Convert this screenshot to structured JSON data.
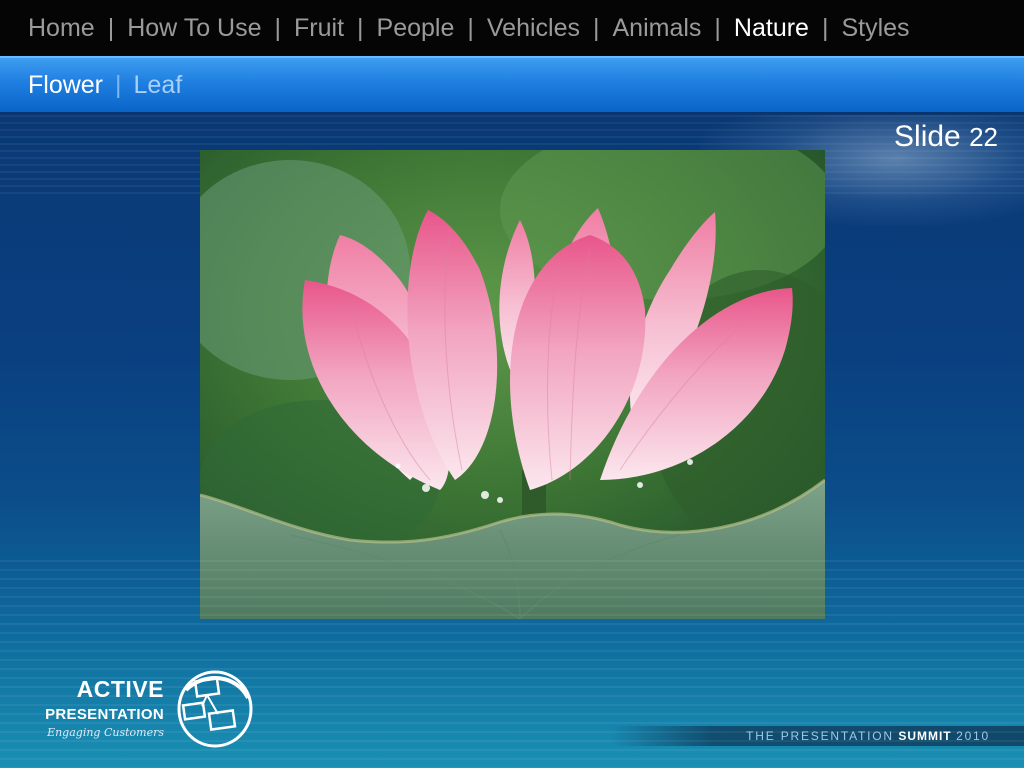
{
  "top_nav": {
    "items": [
      {
        "label": "Home"
      },
      {
        "label": "How To Use"
      },
      {
        "label": "Fruit"
      },
      {
        "label": "People"
      },
      {
        "label": "Vehicles"
      },
      {
        "label": "Animals"
      },
      {
        "label": "Nature"
      },
      {
        "label": "Styles"
      }
    ],
    "active": "Nature",
    "separator": "|"
  },
  "sub_nav": {
    "items": [
      {
        "label": "Flower"
      },
      {
        "label": "Leaf"
      }
    ],
    "active": "Flower",
    "separator": "|"
  },
  "slide": {
    "label": "Slide",
    "number": "22"
  },
  "photo": {
    "subject": "pink-lotus-flower"
  },
  "logo": {
    "line1": "ACTIVE",
    "line2": "PRESENTATION",
    "tagline": "Engaging Customers"
  },
  "footer": {
    "prefix": "THE PRESENTATION",
    "bold": "SUMMIT",
    "year": "2010"
  },
  "colors": {
    "nav_bg": "#050505",
    "nav_text": "#9a9a9a",
    "nav_active": "#ffffff",
    "subnav_bg": "#1f7fe0",
    "subnav_text": "#a8d0f8",
    "slide_bg": "#0a3f80"
  }
}
